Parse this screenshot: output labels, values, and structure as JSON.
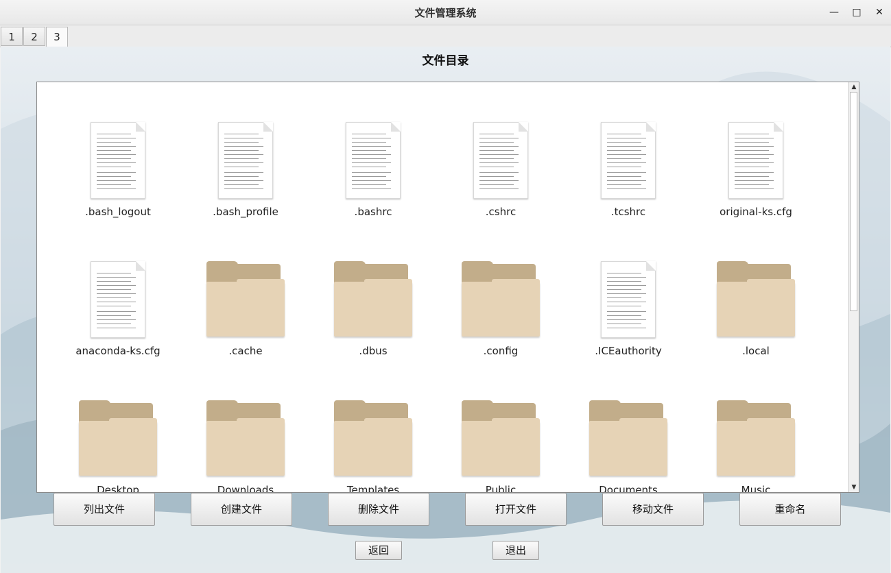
{
  "window": {
    "title": "文件管理系统",
    "minimize_glyph": "—",
    "maximize_glyph": "□",
    "close_glyph": "✕"
  },
  "tabs": [
    {
      "label": "1"
    },
    {
      "label": "2"
    },
    {
      "label": "3",
      "active": true
    }
  ],
  "heading": "文件目录",
  "files": [
    {
      "name": ".bash_logout",
      "type": "document"
    },
    {
      "name": ".bash_profile",
      "type": "document"
    },
    {
      "name": ".bashrc",
      "type": "document"
    },
    {
      "name": ".cshrc",
      "type": "document"
    },
    {
      "name": ".tcshrc",
      "type": "document"
    },
    {
      "name": "original-ks.cfg",
      "type": "document"
    },
    {
      "name": "anaconda-ks.cfg",
      "type": "document"
    },
    {
      "name": ".cache",
      "type": "folder"
    },
    {
      "name": ".dbus",
      "type": "folder"
    },
    {
      "name": ".config",
      "type": "folder"
    },
    {
      "name": ".ICEauthority",
      "type": "document"
    },
    {
      "name": ".local",
      "type": "folder"
    },
    {
      "name": "Desktop",
      "type": "folder"
    },
    {
      "name": "Downloads",
      "type": "folder"
    },
    {
      "name": "Templates",
      "type": "folder"
    },
    {
      "name": "Public",
      "type": "folder"
    },
    {
      "name": "Documents",
      "type": "folder"
    },
    {
      "name": "Music",
      "type": "folder"
    }
  ],
  "actions": {
    "list": "列出文件",
    "create": "创建文件",
    "delete": "删除文件",
    "open": "打开文件",
    "move": "移动文件",
    "rename": "重命名",
    "back": "返回",
    "exit": "退出"
  },
  "icons": {
    "document": "document-icon",
    "folder": "folder-icon"
  },
  "colors": {
    "folder_back": "#c2ad8a",
    "folder_front": "#e6d3b6"
  }
}
